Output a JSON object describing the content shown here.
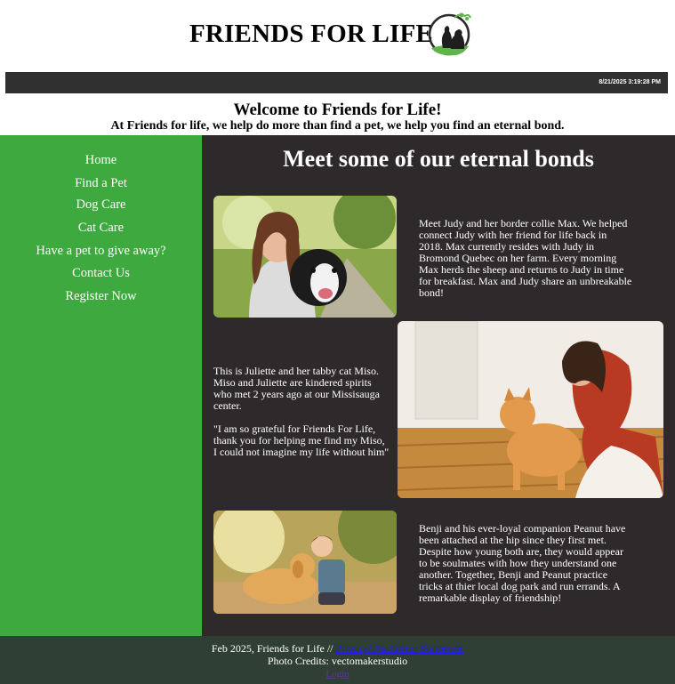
{
  "header": {
    "title": "FRIENDS FOR LIFE",
    "logo_icon": "dog-and-cat-logo-icon"
  },
  "datebar": {
    "timestamp": "8/21/2025 3:19:28 PM"
  },
  "intro": {
    "welcome": "Welcome to Friends for Life!",
    "tagline": "At Friends for life, we help do more than find a pet, we help you find an eternal bond."
  },
  "nav": {
    "items": [
      {
        "label": "Home"
      },
      {
        "label": "Find a Pet"
      },
      {
        "label": "Dog Care"
      },
      {
        "label": "Cat Care"
      },
      {
        "label": "Have a pet to give away?"
      },
      {
        "label": "Contact Us"
      },
      {
        "label": "Register Now"
      }
    ]
  },
  "main": {
    "title": "Meet some of our eternal bonds",
    "stories": [
      {
        "lines": [
          "Meet Judy and her border collie Max. We helped",
          "connect Judy with her friend for life back in",
          "2018. Max currently resides with Judy in",
          "Bromond Quebec on her farm. Every morning",
          "Max herds the sheep and returns to Judy in time",
          "for breakfast. Max and Judy share an unbreakable",
          "bond!"
        ]
      },
      {
        "lines": [
          "This is Juliette and her tabby cat Miso.",
          "Miso and Juliette are kindered spirits",
          "who met 2 years ago at our Missisauga",
          "center.",
          "",
          "\"I am so grateful for Friends For Life,",
          "thank you for helping me find my Miso,",
          "I could not imagine my life without him\""
        ]
      },
      {
        "lines": [
          "Benji and his ever-loyal companion Peanut have",
          "been attached at the hip since they first met.",
          "Despite how young both are, they would appear",
          "to be soulmates with how they understand one",
          "another. Together, Benji and Peanut practice",
          "tricks at thier local dog park and run errands. A",
          "remarkable display of friendship!"
        ]
      }
    ]
  },
  "footer": {
    "copyright": "Feb 2025, Friends for Life // ",
    "privacy_link": "Privacy/Disclaimer Statement",
    "credits": "Photo Credits: vectomakerstudio",
    "login_link": "Login"
  },
  "colors": {
    "sidebar": "#3ea93f",
    "main": "#2e2a2b",
    "datebar": "#303030",
    "footer": "#2f3f33"
  }
}
